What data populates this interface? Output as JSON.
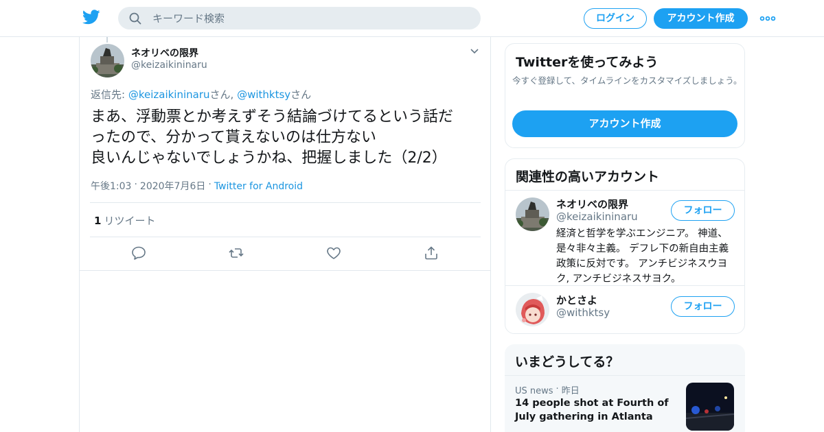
{
  "header": {
    "search_placeholder": "キーワード検索",
    "login_label": "ログイン",
    "signup_label": "アカウント作成",
    "brand_color": "#1da1f2"
  },
  "tweet": {
    "author_name": "ネオリベの限界",
    "author_handle": "@keizaikininaru",
    "reply_prefix": "返信先: ",
    "reply_user1": "@keizaikininaru",
    "reply_suffix1": "さん, ",
    "reply_user2": "@withktsy",
    "reply_suffix2": "さん",
    "text_line1": "まあ、浮動票とか考えずそう結論づけてるという話だ",
    "text_line2": "ったので、分かって貰えないのは仕方ない",
    "text_line3": "良いんじゃないでしょうかね、把握しました（2/2）",
    "time": "午後1:03",
    "date": "2020年7月6日",
    "source": "Twitter for Android",
    "retweet_count": "1",
    "retweet_label": "リツイート",
    "icons": [
      "reply-icon",
      "retweet-icon",
      "like-icon",
      "share-icon"
    ]
  },
  "sidebar": {
    "signup_card": {
      "title": "Twitterを使ってみよう",
      "description": "今すぐ登録して、タイムラインをカスタマイズしましょう。",
      "button_label": "アカウント作成"
    },
    "related": {
      "title": "関連性の高いアカウント",
      "accounts": [
        {
          "name": "ネオリベの限界",
          "handle": "@keizaikininaru",
          "bio": "経済と哲学を学ぶエンジニア。 神道、是々非々主義。 デフレ下の新自由主義政策に反対です。 アンチビジネスウヨク, アンチビジネスサヨク。",
          "follow_label": "フォロー"
        },
        {
          "name": "かとさよ",
          "handle": "@withktsy",
          "follow_label": "フォロー"
        }
      ]
    },
    "trends": {
      "title": "いまどうしてる？",
      "items": [
        {
          "category": "US news",
          "time": "昨日",
          "headline": "14 people shot at Fourth of July gathering in Atlanta"
        }
      ]
    }
  }
}
